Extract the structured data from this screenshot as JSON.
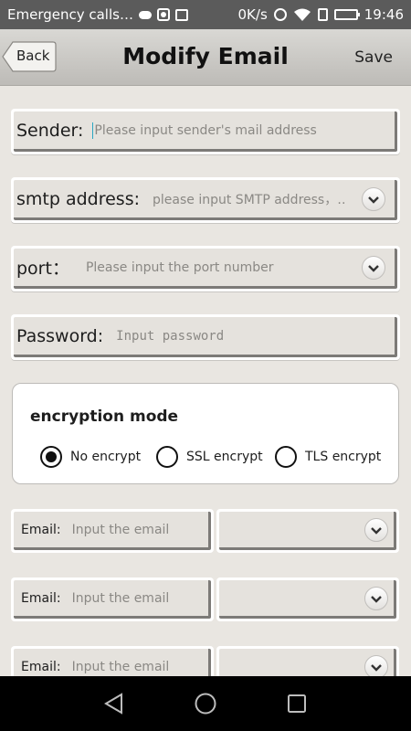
{
  "status_bar": {
    "carrier": "Emergency calls…",
    "speed": "0K/s",
    "time": "19:46",
    "icons": [
      "cloud-icon",
      "camera-icon",
      "image-icon",
      "alarm-icon",
      "wifi-icon",
      "sim-icon",
      "battery-icon"
    ]
  },
  "header": {
    "back_label": "Back",
    "title": "Modify Email",
    "save_label": "Save"
  },
  "form": {
    "sender": {
      "label": "Sender:",
      "placeholder": "Please input sender's mail address"
    },
    "smtp": {
      "label": "smtp address:",
      "placeholder": "please input SMTP address，…"
    },
    "port": {
      "label": "port：",
      "placeholder": "Please input the port number"
    },
    "password": {
      "label": "Password:",
      "placeholder": "Input password"
    }
  },
  "encryption": {
    "title": "encryption mode",
    "options": [
      {
        "label": "No encrypt",
        "selected": true
      },
      {
        "label": "SSL encrypt",
        "selected": false
      },
      {
        "label": "TLS encrypt",
        "selected": false
      }
    ]
  },
  "emails": [
    {
      "label": "Email:",
      "placeholder": "Input the email",
      "domain": ""
    },
    {
      "label": "Email:",
      "placeholder": "Input the email",
      "domain": ""
    },
    {
      "label": "Email:",
      "placeholder": "Input the email",
      "domain": ""
    }
  ],
  "system_nav": [
    "back-triangle-icon",
    "home-circle-icon",
    "recents-square-icon"
  ],
  "colors": {
    "caret": "#2aa7c2",
    "status_bar": "#5b5b5b",
    "nav_bar": "#000000"
  }
}
